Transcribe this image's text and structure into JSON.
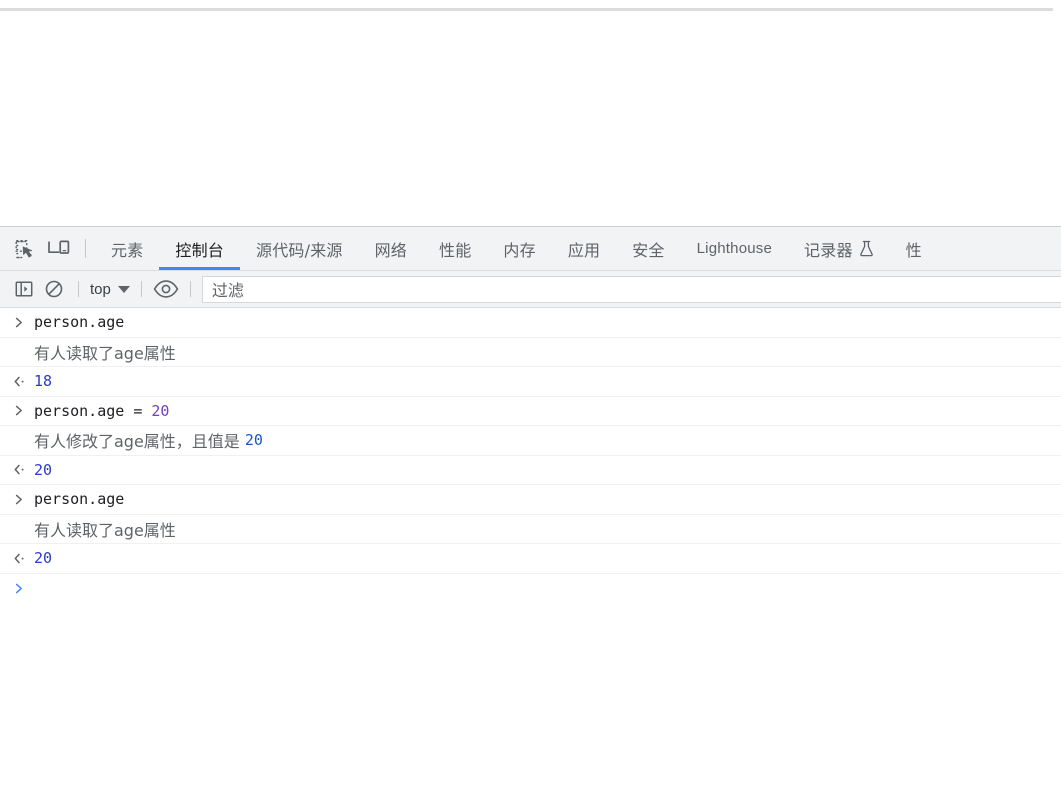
{
  "colors": {
    "accent": "#4285f4",
    "tab_active_text": "#202124",
    "tab_text": "#5f6368",
    "toolbar_bg": "#f1f3f4",
    "console_bg": "#ffffff",
    "message_text": "#5f6368",
    "number_literal": "#6f42c1",
    "number_log": "#1a56c4",
    "result_value": "#2a3cc4",
    "prompt_active": "#4285f4",
    "row_separator": "#f0f0f0"
  },
  "page": {
    "body_text": ""
  },
  "devtools": {
    "tabstrip": {
      "inspect_icon": "inspect-element-icon",
      "device_icon": "device-toolbar-icon",
      "tabs": [
        {
          "label": "元素",
          "active": false,
          "name": "tab-elements"
        },
        {
          "label": "控制台",
          "active": true,
          "name": "tab-console"
        },
        {
          "label": "源代码/来源",
          "active": false,
          "name": "tab-sources"
        },
        {
          "label": "网络",
          "active": false,
          "name": "tab-network"
        },
        {
          "label": "性能",
          "active": false,
          "name": "tab-performance"
        },
        {
          "label": "内存",
          "active": false,
          "name": "tab-memory"
        },
        {
          "label": "应用",
          "active": false,
          "name": "tab-application"
        },
        {
          "label": "安全",
          "active": false,
          "name": "tab-security"
        },
        {
          "label": "Lighthouse",
          "active": false,
          "name": "tab-lighthouse"
        },
        {
          "label": "记录器",
          "active": false,
          "name": "tab-recorder",
          "experimental_icon": "flask-icon"
        },
        {
          "label": "性",
          "active": false,
          "name": "tab-performance-insights-truncated"
        }
      ]
    },
    "console_toolbar": {
      "sidebar_icon": "console-sidebar-icon",
      "clear_icon": "clear-console-icon",
      "context": {
        "value": "top",
        "caret_icon": "chevron-down-icon"
      },
      "eye_icon": "live-expression-eye-icon",
      "filter": {
        "placeholder": "过滤",
        "value": ""
      }
    },
    "console_log": {
      "rows": [
        {
          "kind": "input",
          "prompt": "›",
          "code": "person.age",
          "name": "console-input-line"
        },
        {
          "kind": "message",
          "text": "有人读取了age属性",
          "name": "console-message-line"
        },
        {
          "kind": "result",
          "prompt": "‹",
          "value": "18",
          "name": "console-result-line"
        },
        {
          "kind": "input",
          "prompt": "›",
          "code": "person.age = ",
          "literal": "20",
          "name": "console-input-line"
        },
        {
          "kind": "message",
          "text": "有人修改了age属性，且值是 ",
          "number": "20",
          "name": "console-message-line"
        },
        {
          "kind": "result",
          "prompt": "‹",
          "value": "20",
          "name": "console-result-line"
        },
        {
          "kind": "input",
          "prompt": "›",
          "code": "person.age",
          "name": "console-input-line"
        },
        {
          "kind": "message",
          "text": "有人读取了age属性",
          "name": "console-message-line"
        },
        {
          "kind": "result",
          "prompt": "‹",
          "value": "20",
          "name": "console-result-line"
        },
        {
          "kind": "prompt",
          "prompt": "›",
          "code": "",
          "name": "console-active-prompt"
        }
      ]
    }
  }
}
